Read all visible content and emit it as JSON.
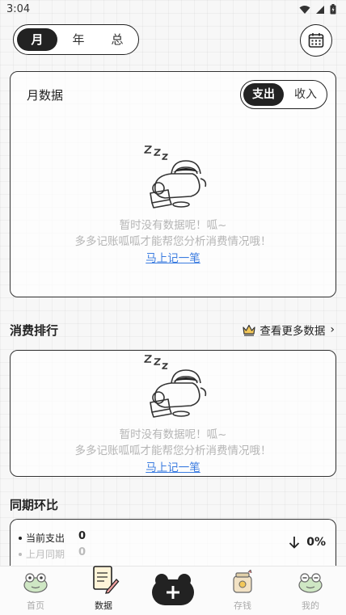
{
  "status_bar": {
    "time": "3:04"
  },
  "period_tabs": [
    "月",
    "年",
    "总"
  ],
  "overview_card": {
    "title": "月数据",
    "toggle": [
      "支出",
      "收入"
    ]
  },
  "empty_state": {
    "line1": "暂时没有数据呢！呱~",
    "line2": "多多记账呱呱才能帮您分析消费情况哦！",
    "link": "马上记一笔"
  },
  "ranking": {
    "title": "消费排行",
    "more_label": "查看更多数据"
  },
  "comparison": {
    "title": "同期环比",
    "current_label": "当前支出",
    "current_value": "0",
    "last_label": "上月同期",
    "last_value": "0",
    "change": "0%"
  },
  "bottom_nav": {
    "home": "首页",
    "data": "数据",
    "save": "存钱",
    "mine": "我的"
  },
  "colors": {
    "accent": "#222222",
    "link": "#3a7be0",
    "muted": "#b5b5b5"
  }
}
